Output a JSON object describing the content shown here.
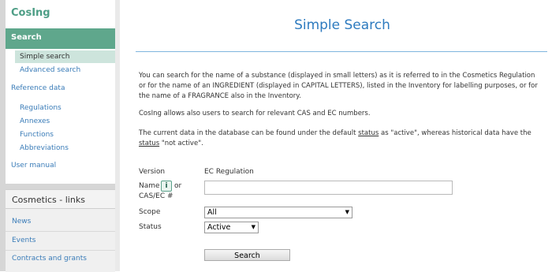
{
  "sidebar": {
    "logo": "CosIng",
    "search_label": "Search",
    "simple_search": "Simple search",
    "advanced_search": "Advanced search",
    "reference_data": "Reference data",
    "reference_items": [
      "Regulations",
      "Annexes",
      "Functions",
      "Abbreviations"
    ],
    "user_manual": "User manual",
    "links_title": "Cosmetics - links",
    "links_items": [
      "News",
      "Events",
      "Contracts and grants"
    ]
  },
  "main": {
    "title": "Simple Search",
    "para1": "You can search for the name of a substance (displayed in small letters) as it is referred to in the Cosmetics Regulation or for the name of an INGREDIENT (displayed in CAPITAL LETTERS), listed in the Inventory for labelling purposes, or for the name of a FRAGRANCE also in the Inventory.",
    "para2": "CosIng allows also users to search for relevant CAS and EC numbers.",
    "para3_a": "The current data in the database can be found under the default ",
    "para3_status1": "status",
    "para3_b": " as \"active\", whereas historical data have the ",
    "para3_status2": "status",
    "para3_c": " \"not active\"."
  },
  "form": {
    "version_label": "Version",
    "version_value": "EC Regulation",
    "name_label": "Name",
    "info_icon": "i",
    "or_label": "or",
    "cas_label": "CAS/EC #",
    "name_value": "",
    "scope_label": "Scope",
    "scope_value": "All",
    "status_label": "Status",
    "status_value": "Active",
    "search_button": "Search"
  },
  "colors": {
    "accent_green": "#5fa78c",
    "title_blue": "#2e7bbf",
    "link_blue": "#3a7cb8"
  }
}
